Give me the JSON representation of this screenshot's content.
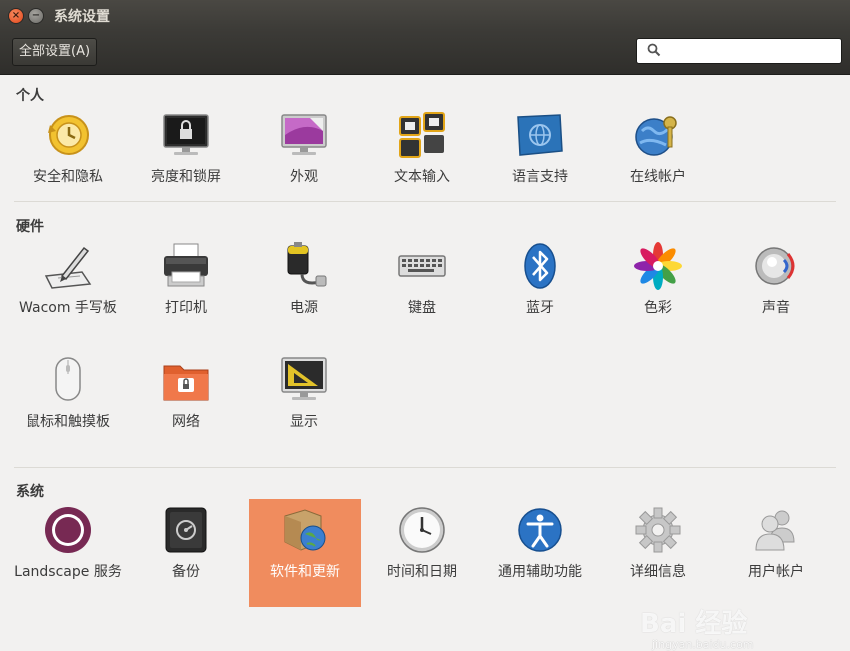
{
  "window": {
    "title": "系统设置",
    "close_glyph": "×",
    "minimize_glyph": "−"
  },
  "toolbar": {
    "all_settings_label": "全部设置(A)",
    "search_placeholder": ""
  },
  "sections": {
    "personal": {
      "title": "个人",
      "items": [
        {
          "label": "安全和隐私",
          "icon": "security-privacy-icon"
        },
        {
          "label": "亮度和锁屏",
          "icon": "brightness-lock-icon"
        },
        {
          "label": "外观",
          "icon": "appearance-icon"
        },
        {
          "label": "文本输入",
          "icon": "text-entry-icon"
        },
        {
          "label": "语言支持",
          "icon": "language-support-icon"
        },
        {
          "label": "在线帐户",
          "icon": "online-accounts-icon"
        }
      ]
    },
    "hardware": {
      "title": "硬件",
      "items": [
        {
          "label": "Wacom 手写板",
          "icon": "wacom-tablet-icon"
        },
        {
          "label": "打印机",
          "icon": "printer-icon"
        },
        {
          "label": "电源",
          "icon": "power-icon"
        },
        {
          "label": "键盘",
          "icon": "keyboard-icon"
        },
        {
          "label": "蓝牙",
          "icon": "bluetooth-icon"
        },
        {
          "label": "色彩",
          "icon": "color-icon"
        },
        {
          "label": "声音",
          "icon": "sound-icon"
        },
        {
          "label": "鼠标和触摸板",
          "icon": "mouse-touchpad-icon"
        },
        {
          "label": "网络",
          "icon": "network-icon"
        },
        {
          "label": "显示",
          "icon": "display-icon"
        }
      ]
    },
    "system": {
      "title": "系统",
      "items": [
        {
          "label": "Landscape 服务",
          "icon": "landscape-icon"
        },
        {
          "label": "备份",
          "icon": "backup-icon"
        },
        {
          "label": "软件和更新",
          "icon": "software-updates-icon",
          "selected": true
        },
        {
          "label": "时间和日期",
          "icon": "time-date-icon"
        },
        {
          "label": "通用辅助功能",
          "icon": "universal-access-icon"
        },
        {
          "label": "详细信息",
          "icon": "details-icon"
        },
        {
          "label": "用户帐户",
          "icon": "user-accounts-icon"
        }
      ]
    }
  },
  "watermark": {
    "text": "Bai 经验",
    "sub": "jingyan.baidu.com"
  },
  "colors": {
    "selection": "#f08c5e",
    "titlebar": "#3c3b37",
    "background": "#f2f1f0"
  }
}
